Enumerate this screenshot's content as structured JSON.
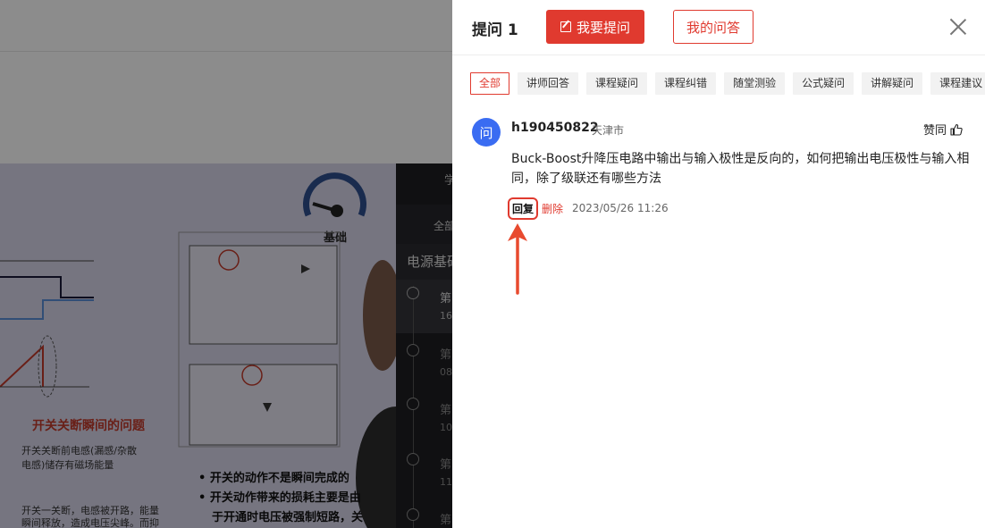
{
  "background": {
    "video_gauge_label": "基础",
    "slide_heading": "开关关断瞬间的问题",
    "slide_lines": [
      "开关关断前电感(漏感/杂散电感)储存有磁场能量",
      "开关一关断，电感被开路，能量瞬间释放，造成电压尖峰。而抑"
    ],
    "slide_bullets": [
      "开关的动作不是瞬间完成的",
      "开关动作带来的损耗主要是由于开通时电压被强制短路，关"
    ],
    "side_tab": "学",
    "side_all": "全部",
    "side_course": "电源基础",
    "side_items": [
      "第",
      "16",
      "第",
      "08",
      "第",
      "10",
      "第",
      "11",
      "第"
    ]
  },
  "drawer": {
    "title": "提问 1",
    "ask_button": "我要提问",
    "my_answers_button": "我的问答",
    "close_icon": "close-icon",
    "tabs": [
      "全部",
      "讲师回答",
      "课程疑问",
      "课程纠错",
      "随堂测验",
      "公式疑问",
      "讲解疑问",
      "课程建议"
    ],
    "active_tab": 0,
    "question": {
      "avatar_char": "问",
      "username": "h190450822",
      "location": "天津市",
      "like_label": "赞同",
      "text": "Buck-Boost升降压电路中输出与输入极性是反向的，如何把输出电压极性与输入相同，除了级联还有哪些方法",
      "reply_label": "回复",
      "delete_label": "删除",
      "timestamp": "2023/05/26 11:26"
    }
  },
  "colors": {
    "accent": "#e03a2f",
    "avatar": "#3a6cf2"
  }
}
